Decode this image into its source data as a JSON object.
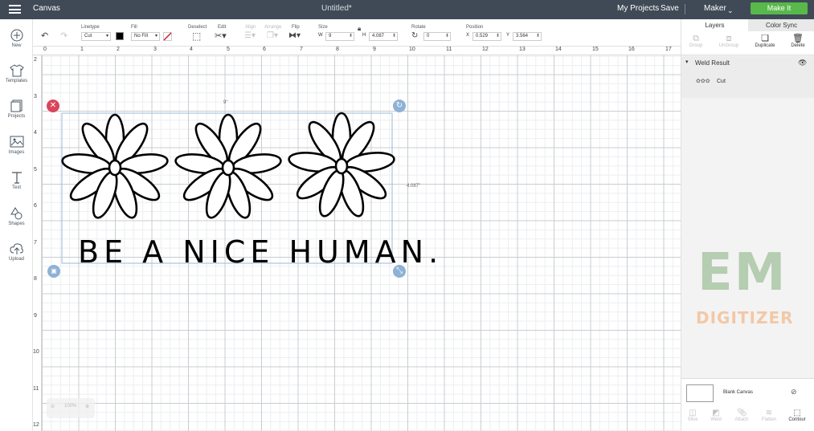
{
  "topbar": {
    "app_title": "Canvas",
    "doc_title": "Untitled*",
    "my_projects": "My Projects",
    "save": "Save",
    "machine": "Maker",
    "make_it": "Make It"
  },
  "sidebar": {
    "items": [
      {
        "label": "New",
        "icon": "plus-circle-icon"
      },
      {
        "label": "Templates",
        "icon": "tshirt-icon"
      },
      {
        "label": "Projects",
        "icon": "projects-icon"
      },
      {
        "label": "Images",
        "icon": "image-icon"
      },
      {
        "label": "Text",
        "icon": "text-icon"
      },
      {
        "label": "Shapes",
        "icon": "shapes-icon"
      },
      {
        "label": "Upload",
        "icon": "upload-icon"
      }
    ]
  },
  "toolbar": {
    "linetype_label": "Linetype",
    "linetype_value": "Cut",
    "fill_label": "Fill",
    "fill_value": "No Fill",
    "deselect_label": "Deselect",
    "edit_label": "Edit",
    "align_label": "Align",
    "arrange_label": "Arrange",
    "flip_label": "Flip",
    "size_label": "Size",
    "w_label": "W",
    "w_value": "9",
    "h_label": "H",
    "h_value": "4.087",
    "rotate_label": "Rotate",
    "rotate_value": "0",
    "position_label": "Position",
    "x_label": "X",
    "x_value": "0.529",
    "y_label": "Y",
    "y_value": "3.564"
  },
  "rulers": {
    "top": [
      "0",
      "1",
      "2",
      "3",
      "4",
      "5",
      "6",
      "7",
      "8",
      "9",
      "10",
      "11",
      "12",
      "13",
      "14",
      "15",
      "16",
      "17"
    ],
    "left": [
      "2",
      "3",
      "4",
      "5",
      "6",
      "7",
      "8",
      "9",
      "10",
      "11",
      "12"
    ]
  },
  "canvas": {
    "width_label": "9\"",
    "height_label": "4.087\"",
    "design_text": "BE A NICE HUMAN.",
    "zoom": "100%"
  },
  "panel": {
    "tab_layers": "Layers",
    "tab_colorsync": "Color Sync",
    "group": "Group",
    "ungroup": "UnGroup",
    "duplicate": "Duplicate",
    "delete": "Delete",
    "weld_result": "Weld Result",
    "layer_cut": "Cut",
    "blank_canvas": "Blank Canvas",
    "slice": "Slice",
    "weld": "Weld",
    "attach": "Attach",
    "flatten": "Flatten",
    "contour": "Contour"
  },
  "watermark": {
    "em": "EM",
    "digitizer": "DIGITIZER"
  },
  "colors": {
    "topbar": "#3f4a56",
    "make_it": "#58b84a",
    "delete_handle": "#d9465b",
    "handle_blue": "#8fb1d6"
  }
}
